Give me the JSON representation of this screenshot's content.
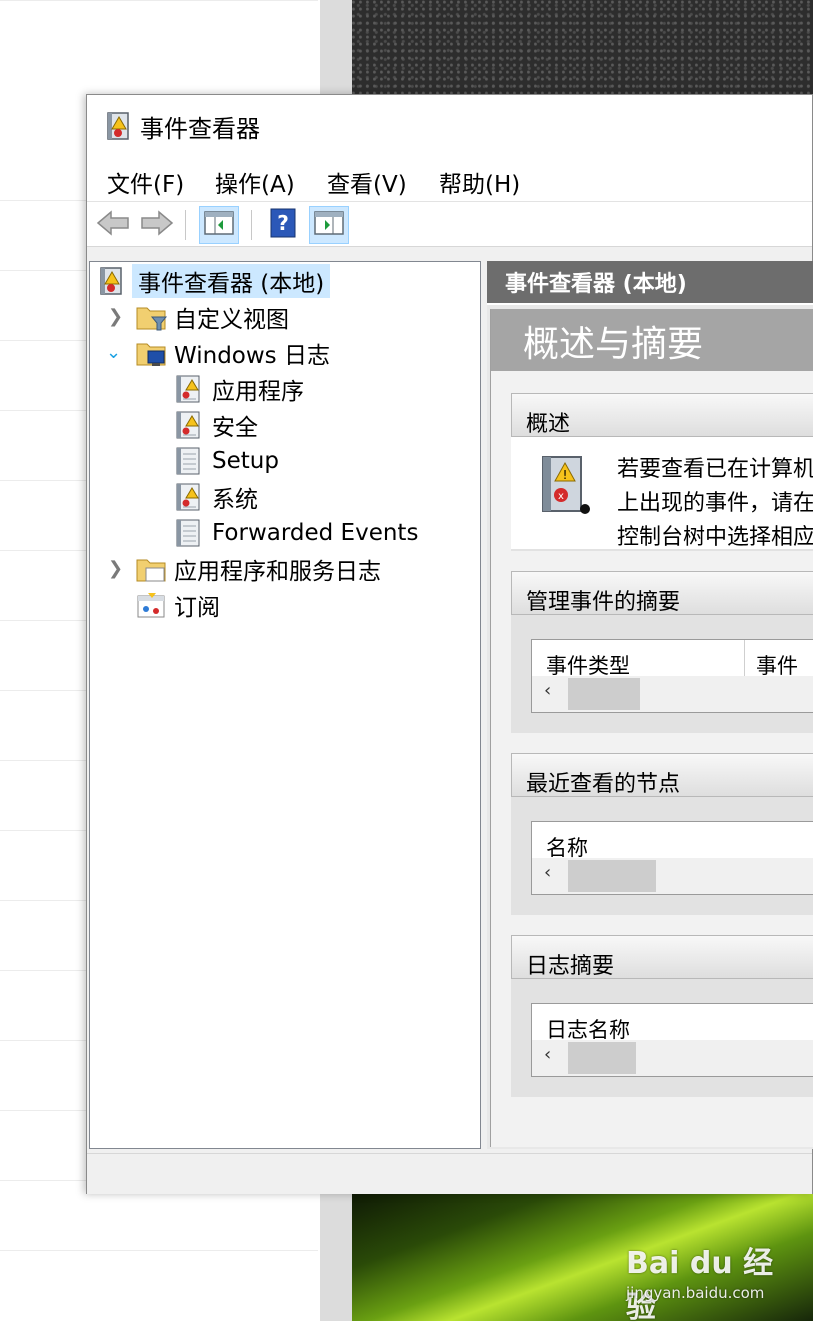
{
  "window": {
    "title": "事件查看器",
    "icon": "event-viewer-icon"
  },
  "menu": [
    {
      "label": "文件(F)"
    },
    {
      "label": "操作(A)"
    },
    {
      "label": "查看(V)"
    },
    {
      "label": "帮助(H)"
    }
  ],
  "toolbar": {
    "back": "back-arrow-icon",
    "forward": "forward-arrow-icon",
    "show_hide_tree": "show-hide-console-tree-icon",
    "help": "help-icon",
    "show_hide_action": "show-hide-action-pane-icon"
  },
  "tree": {
    "root": "事件查看器 (本地)",
    "custom_views": "自定义视图",
    "windows_logs": "Windows 日志",
    "application": "应用程序",
    "security": "安全",
    "setup": "Setup",
    "system": "系统",
    "forwarded": "Forwarded Events",
    "app_service_logs": "应用程序和服务日志",
    "subscriptions": "订阅"
  },
  "right": {
    "header": "事件查看器 (本地)",
    "banner": "概述与摘要",
    "overview": {
      "title": "概述",
      "line1": "若要查看已在计算机",
      "line2": "上出现的事件，请在",
      "line3": "控制台树中选择相应"
    },
    "admin_summary": {
      "title": "管理事件的摘要",
      "col1": "事件类型",
      "col2": "事件"
    },
    "recent_nodes": {
      "title": "最近查看的节点",
      "col1": "名称"
    },
    "log_summary": {
      "title": "日志摘要",
      "col1": "日志名称"
    },
    "scroll_left": "‹"
  },
  "watermark": {
    "logo": "Bai du 经验",
    "url": "jingyan.baidu.com"
  },
  "colors": {
    "selection": "#cce8ff",
    "header_gray": "#6d6d6d",
    "banner_gray": "#a5a5a5",
    "expand_arrow": "#1ba1e2"
  }
}
